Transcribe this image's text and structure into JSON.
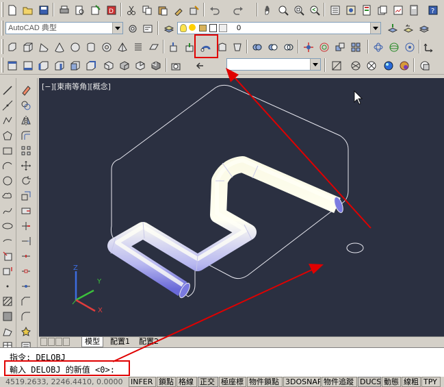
{
  "toolbar_workspace": {
    "workspace_name": "AutoCAD 典型",
    "layer_value": "0"
  },
  "toolbar_visual": {
    "style_value": ""
  },
  "viewport": {
    "label": "[−][東南等角][概念]",
    "ucs_x": "X",
    "ucs_y": "Y",
    "ucs_z": "Z"
  },
  "layout_tabs": [
    "模型",
    "配置1",
    "配置2"
  ],
  "command": {
    "history": "指令: DELOBJ",
    "prompt": "輸入 DELOBJ 的新值 <0>:"
  },
  "status": {
    "coordinates": "4519.2633, 2246.4410, 0.0000",
    "buttons": [
      {
        "label": "INFER",
        "on": false
      },
      {
        "label": "鎖點",
        "on": false
      },
      {
        "label": "格線",
        "on": false
      },
      {
        "label": "正交",
        "on": true
      },
      {
        "label": "極座標",
        "on": false
      },
      {
        "label": "物件鎖點",
        "on": false
      },
      {
        "label": "3DOSNAP",
        "on": false
      },
      {
        "label": "物件追蹤",
        "on": false
      },
      {
        "label": "DUCS",
        "on": true
      },
      {
        "label": "動態",
        "on": false
      },
      {
        "label": "線粗",
        "on": false
      },
      {
        "label": "TPY",
        "on": false
      }
    ]
  },
  "colors": {
    "viewport_bg": "#2b3041",
    "annotation": "#e00000",
    "ucs_x": "#e03c3c",
    "ucs_y": "#3cc03c",
    "ucs_z": "#3c6ce0"
  }
}
